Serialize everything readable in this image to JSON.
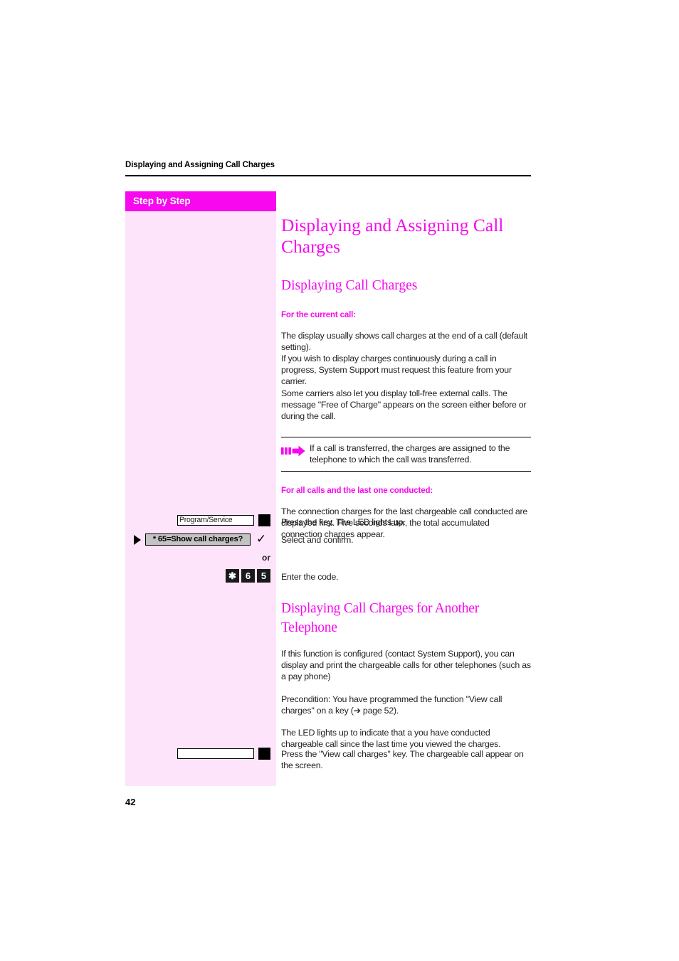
{
  "document": {
    "running_header": "Displaying and Assigning Call Charges",
    "page_number": "42"
  },
  "sidebar": {
    "title": "Step by Step"
  },
  "content": {
    "h1": "Displaying and Assigning Call Charges",
    "section1": {
      "h2": "Displaying Call Charges",
      "h3_current": "For the current call:",
      "paragraph1": "The display usually shows call charges at the end of a call (default setting).\nIf you wish to display charges continuously during a call in progress, System Support must request this feature from your carrier.\nSome carriers also let you display toll-free external calls. The message \"Free of Charge\" appears on the screen either before or during the call.",
      "note": {
        "icon": "note-arrow-icon",
        "text": "If a call is transferred, the charges are assigned to the telephone to which the call was transferred."
      },
      "h3_all": "For all calls and the last one conducted:",
      "paragraph2": "The connection charges for the last chargeable call conducted are displayed first. Five seconds later, the total accumulated connection charges appear."
    },
    "steps": [
      {
        "key_label": "Program/Service",
        "led": "black-led",
        "instruction": "Press the key. The LED lights up."
      },
      {
        "display_value": "* 65=Show call charges?",
        "nav_icon": "nav-triangle-icon",
        "confirm_icon": "confirm-check-icon",
        "instruction": "Select and confirm."
      },
      {
        "or": "or"
      },
      {
        "keycaps": [
          "✱",
          "6",
          "5"
        ],
        "instruction": "Enter the code."
      }
    ],
    "section2": {
      "h2": "Displaying Call Charges for Another Telephone",
      "paragraph1": "If this function is configured (contact System Support), you can display and print the chargeable calls for other telephones (such as a pay phone)",
      "paragraph2_pre": "Precondition: You have programmed the function \"View call charges\" on a key (",
      "paragraph2_arrow": "➔",
      "paragraph2_post": " page 52).",
      "paragraph3": "The LED lights up to indicate that a you have conducted chargeable call since the last time you viewed the charges.",
      "final_step": {
        "key_label": "",
        "led": "black-led",
        "instruction": "Press the \"View call charges\" key. The chargeable call appear on the screen."
      }
    }
  },
  "colors": {
    "magenta": "#f708ef",
    "sidebar_bg": "#fde4fb",
    "body_text": "#231f20",
    "display_bg": "#c3c3c3"
  }
}
